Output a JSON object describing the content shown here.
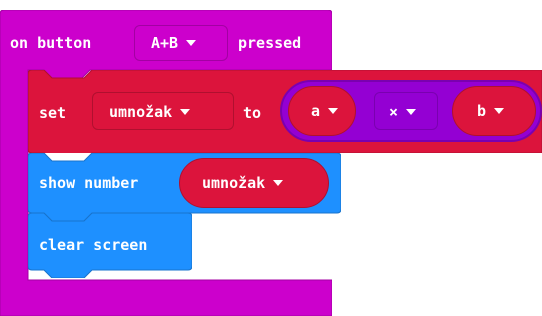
{
  "event_block": {
    "prefix": "on button",
    "button_value": "A+B",
    "suffix": "pressed"
  },
  "set_block": {
    "label": "set",
    "variable": "umnožak",
    "to_label": "to",
    "operand_left": "a",
    "operator": "×",
    "operand_right": "b"
  },
  "show_number_block": {
    "label": "show number",
    "variable": "umnožak"
  },
  "clear_screen_block": {
    "label": "clear screen"
  },
  "colors": {
    "events": "#cc00cc",
    "variables": "#dc143c",
    "math": "#9400d3",
    "basic": "#1e90ff"
  }
}
